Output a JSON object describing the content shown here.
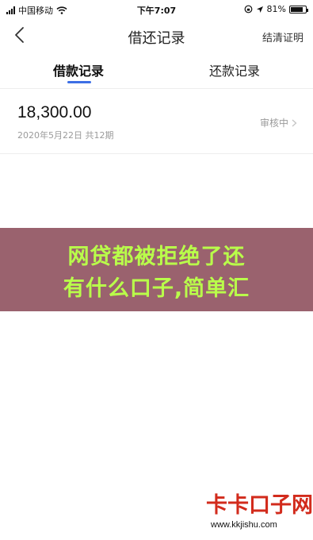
{
  "status_bar": {
    "carrier": "中国移动",
    "time": "下午7:07",
    "battery": "81%",
    "battery_level": 0.81,
    "icons": [
      "signal-icon",
      "wifi-icon",
      "lock-rotation-icon",
      "location-icon",
      "battery-icon"
    ]
  },
  "nav": {
    "title": "借还记录",
    "action_label": "结清证明",
    "back_icon": "chevron-left-icon"
  },
  "tabs": [
    {
      "label": "借款记录",
      "active": true
    },
    {
      "label": "还款记录",
      "active": false
    }
  ],
  "records": [
    {
      "amount": "18,300.00",
      "meta": "2020年5月22日 共12期",
      "status": "审核中"
    }
  ],
  "banner": {
    "line1": "网贷都被拒绝了还",
    "line2": "有什么口子,简单汇"
  },
  "watermark": {
    "name": "卡卡口子网",
    "url": "www.kkjishu.com"
  },
  "colors": {
    "accent": "#3d6fe5",
    "banner_bg": "#9a626e",
    "banner_text": "#b9ff4a",
    "logo_red": "#d22b1c",
    "muted_text": "#9a9a9a"
  }
}
